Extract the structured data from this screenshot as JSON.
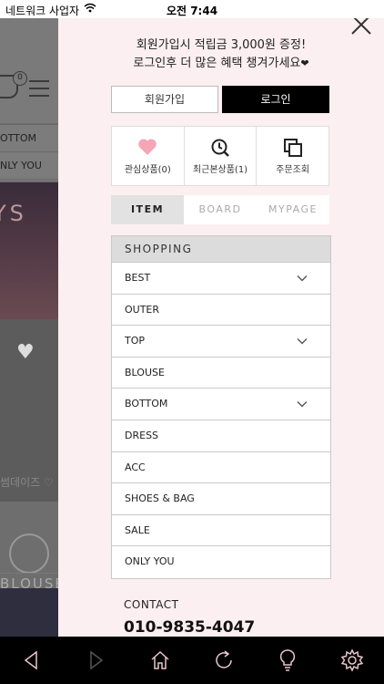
{
  "status_bar": {
    "carrier": "네트워크 사업자",
    "time": "오전 7:44"
  },
  "background_page": {
    "cart_count": "0",
    "nav_items": [
      "OTTOM",
      "NLY YOU"
    ],
    "banner_text": "YS",
    "promo_text": "썸데이즈 ♡",
    "category_tag": "BLOUSE"
  },
  "panel": {
    "promo_line1": "회원가입시 적립금 3,000원 증정!",
    "promo_line2": "로그인후 더 많은 혜택 챙겨가세요",
    "promo_heart": "❤",
    "join_label": "회원가입",
    "login_label": "로그인",
    "quick_links": [
      {
        "label": "관심상품(0)",
        "icon": "heart-icon",
        "color": "#f4a6b6"
      },
      {
        "label": "최근본상품(1)",
        "icon": "clock-search-icon",
        "color": "#333333"
      },
      {
        "label": "주문조회",
        "icon": "copy-icon",
        "color": "#333333"
      }
    ],
    "tabs": [
      {
        "label": "ITEM",
        "active": true
      },
      {
        "label": "BOARD",
        "active": false
      },
      {
        "label": "MYPAGE",
        "active": false
      }
    ],
    "shopping": {
      "header": "SHOPPING",
      "items": [
        {
          "label": "BEST",
          "expandable": true
        },
        {
          "label": "OUTER",
          "expandable": false
        },
        {
          "label": "TOP",
          "expandable": true
        },
        {
          "label": "BLOUSE",
          "expandable": false
        },
        {
          "label": "BOTTOM",
          "expandable": true
        },
        {
          "label": "DRESS",
          "expandable": false
        },
        {
          "label": "ACC",
          "expandable": false
        },
        {
          "label": "SHOES & BAG",
          "expandable": false
        },
        {
          "label": "SALE",
          "expandable": false
        },
        {
          "label": "ONLY YOU",
          "expandable": false
        }
      ]
    },
    "contact_label": "CONTACT",
    "contact_phone": "010-9835-4047"
  },
  "toolbar": {
    "items": [
      "back-icon",
      "forward-icon",
      "home-icon",
      "refresh-icon",
      "lightbulb-icon",
      "settings-icon"
    ]
  },
  "colors": {
    "panel_bg": "#fbeff1",
    "login_bg": "#000000",
    "heart": "#f4a6b6",
    "active_tab_bg": "#e2e2e2"
  }
}
